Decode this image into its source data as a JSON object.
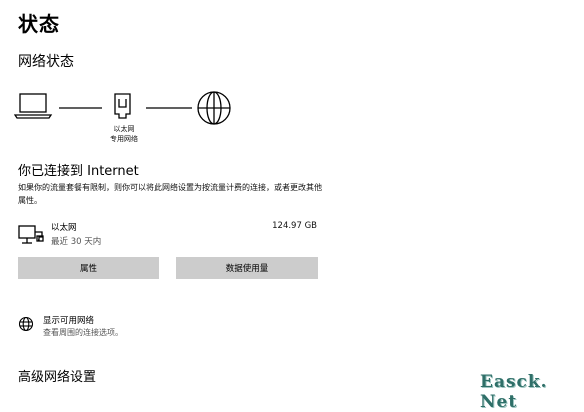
{
  "page": {
    "title": "状态",
    "section_title": "网络状态"
  },
  "diagram": {
    "network_type": "以太网",
    "network_profile": "专用网络",
    "icons": [
      "laptop-icon",
      "ethernet-port-icon",
      "globe-icon"
    ]
  },
  "connection": {
    "title": "你已连接到 Internet",
    "description": "如果你的流量套餐有限制，则你可以将此网络设置为按流量计费的连接，或者更改其他属性。"
  },
  "adapter": {
    "name": "以太网",
    "period": "最近 30 天内",
    "usage": "124.97 GB",
    "icon": "ethernet-pc-icon"
  },
  "buttons": {
    "properties": "属性",
    "data_usage": "数据使用量"
  },
  "available_networks": {
    "label": "显示可用网络",
    "sub": "查看周围的连接选项。",
    "icon": "globe-icon"
  },
  "advanced": {
    "title": "高级网络设置"
  },
  "watermark": "Easck. Net"
}
